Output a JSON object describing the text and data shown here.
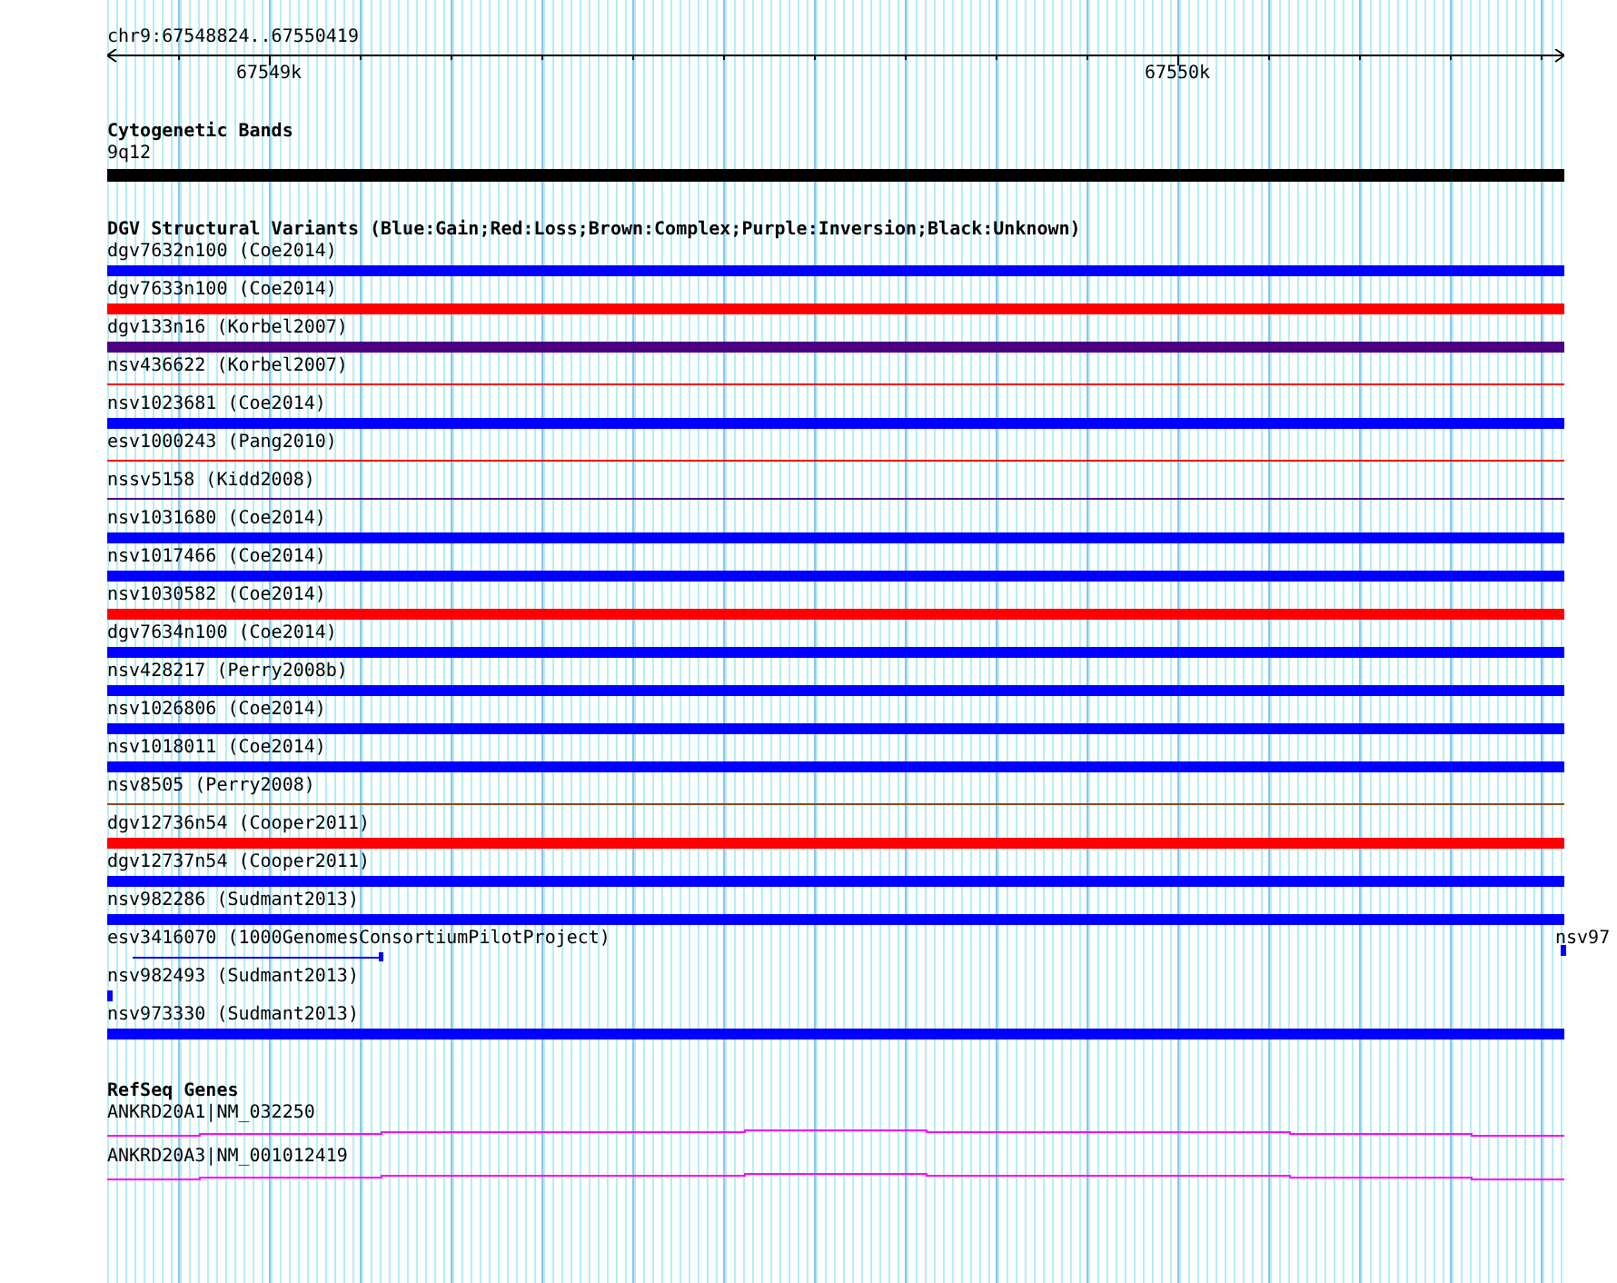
{
  "ruler": {
    "range": "chr9:67548824..67550419",
    "ticks": [
      {
        "label": "67549k"
      },
      {
        "label": "67550k"
      }
    ]
  },
  "cytogenetic_bands": {
    "title": "Cytogenetic Bands",
    "features": [
      {
        "label": "9q12",
        "color": "#000000"
      }
    ]
  },
  "dgv": {
    "title": "DGV Structural Variants (Blue:Gain;Red:Loss;Brown:Complex;Purple:Inversion;Black:Unknown)",
    "features": [
      {
        "label": "dgv7632n100 (Coe2014)",
        "color": "#0000ff",
        "kind": "thick"
      },
      {
        "label": "dgv7633n100 (Coe2014)",
        "color": "#ff0000",
        "kind": "thick"
      },
      {
        "label": "dgv133n16 (Korbel2007)",
        "color": "#4b0082",
        "kind": "thick"
      },
      {
        "label": "nsv436622 (Korbel2007)",
        "color": "#ff0000",
        "kind": "thin"
      },
      {
        "label": "nsv1023681 (Coe2014)",
        "color": "#0000ff",
        "kind": "thick"
      },
      {
        "label": "esv1000243 (Pang2010)",
        "color": "#ff0000",
        "kind": "thin"
      },
      {
        "label": "nssv5158 (Kidd2008)",
        "color": "#4b0082",
        "kind": "thin"
      },
      {
        "label": "nsv1031680 (Coe2014)",
        "color": "#0000ff",
        "kind": "thick"
      },
      {
        "label": "nsv1017466 (Coe2014)",
        "color": "#0000ff",
        "kind": "thick"
      },
      {
        "label": "nsv1030582 (Coe2014)",
        "color": "#ff0000",
        "kind": "thick"
      },
      {
        "label": "dgv7634n100 (Coe2014)",
        "color": "#0000ff",
        "kind": "thick"
      },
      {
        "label": "nsv428217 (Perry2008b)",
        "color": "#0000ff",
        "kind": "thick"
      },
      {
        "label": "nsv1026806 (Coe2014)",
        "color": "#0000ff",
        "kind": "thick"
      },
      {
        "label": "nsv1018011 (Coe2014)",
        "color": "#0000ff",
        "kind": "thick"
      },
      {
        "label": "nsv8505 (Perry2008)",
        "color": "#8b4513",
        "kind": "thin"
      },
      {
        "label": "dgv12736n54 (Cooper2011)",
        "color": "#ff0000",
        "kind": "thick"
      },
      {
        "label": "dgv12737n54 (Cooper2011)",
        "color": "#0000ff",
        "kind": "thick"
      },
      {
        "label": "nsv982286 (Sudmant2013)",
        "color": "#0000ff",
        "kind": "thick"
      },
      {
        "label": "esv3416070 (1000GenomesConsortiumPilotProject)",
        "color": "#0000ff",
        "kind": "segment",
        "edge_label": "nsv97"
      },
      {
        "label": "nsv982493 (Sudmant2013)",
        "color": "#0000ff",
        "kind": "stub"
      },
      {
        "label": "nsv973330 (Sudmant2013)",
        "color": "#0000ff",
        "kind": "thick"
      }
    ]
  },
  "refseq": {
    "title": "RefSeq Genes",
    "genes": [
      {
        "label": "ANKRD20A1|NM_032250"
      },
      {
        "label": "ANKRD20A3|NM_001012419"
      }
    ]
  }
}
